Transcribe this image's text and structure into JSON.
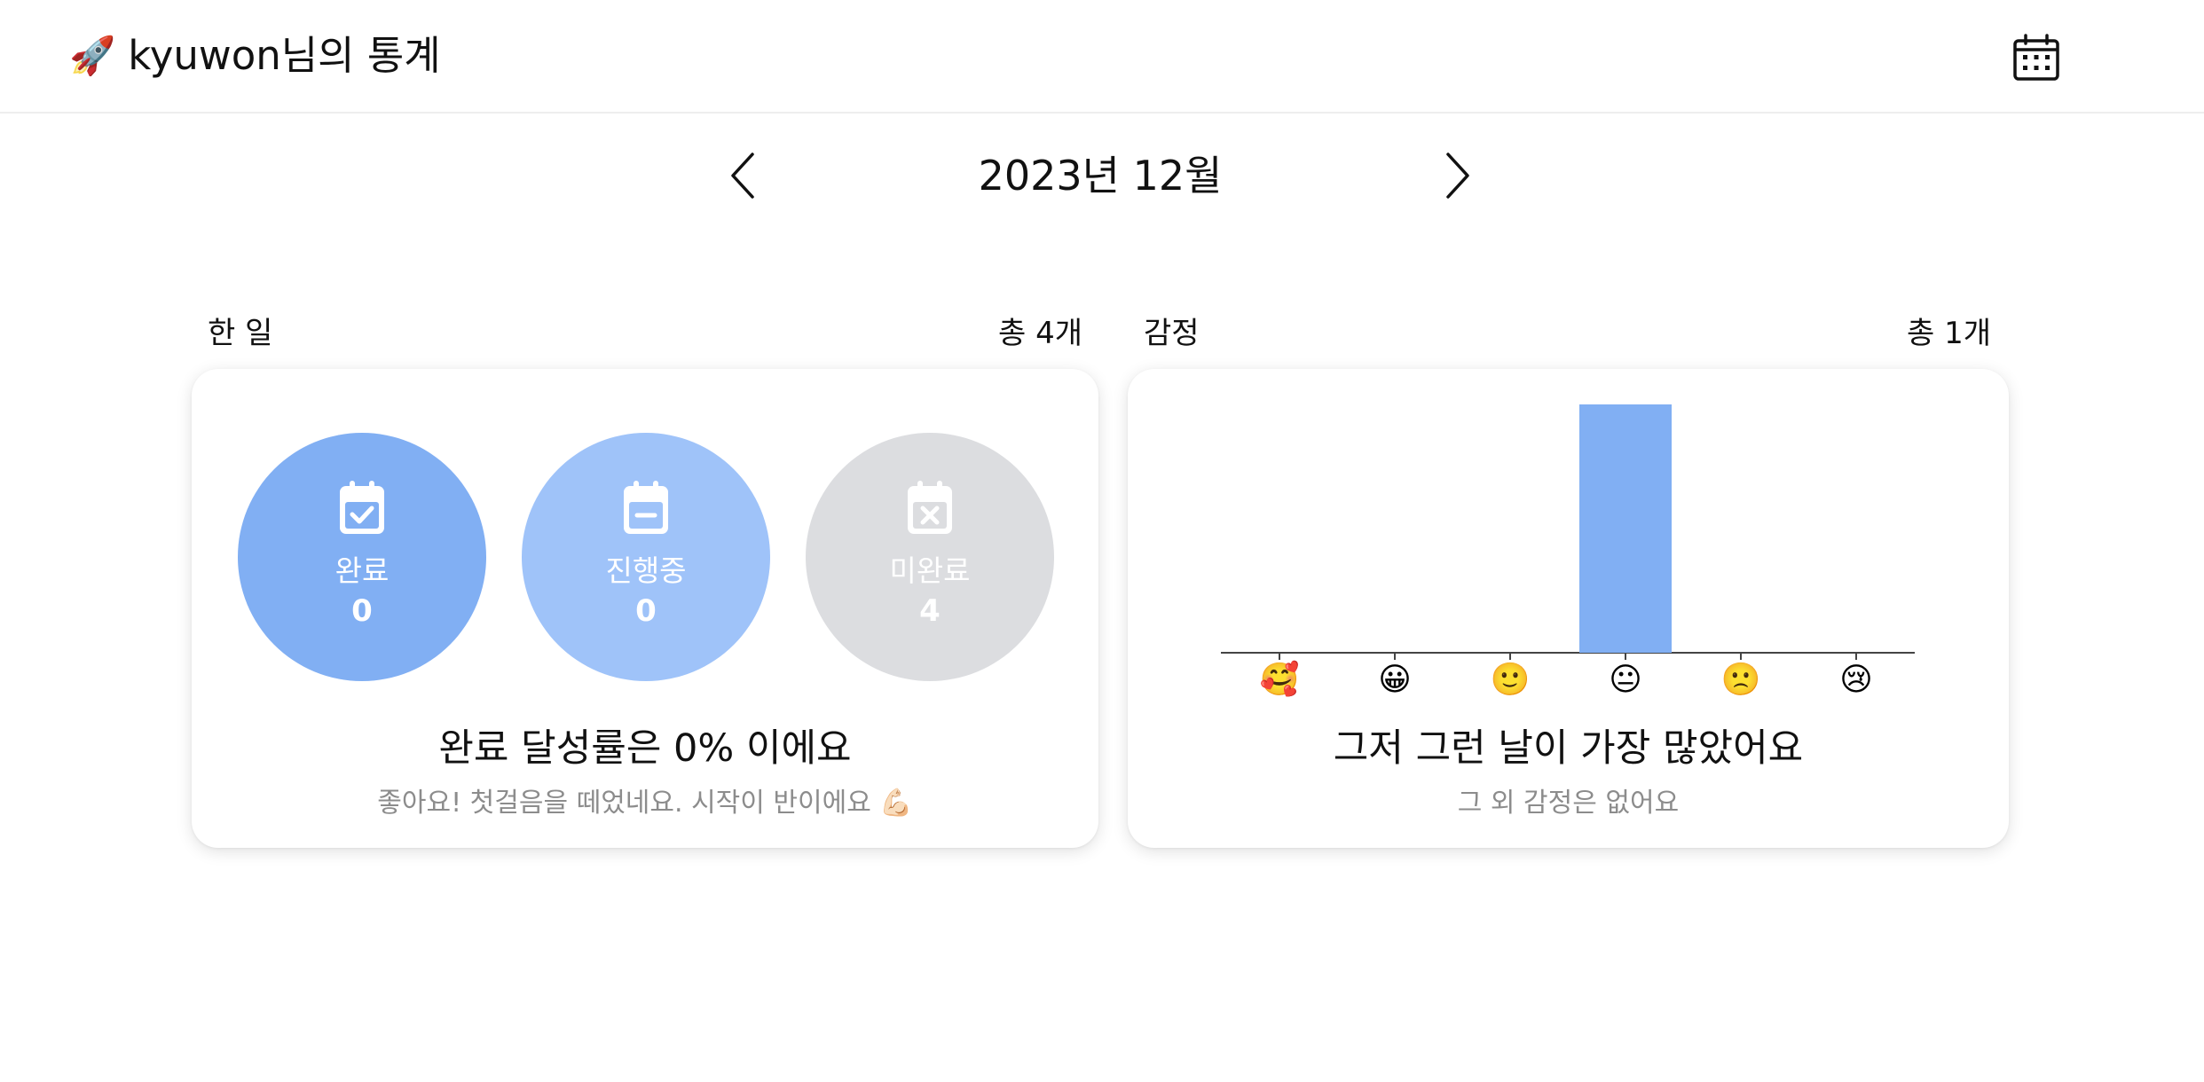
{
  "header": {
    "rocket": "🚀",
    "title": "kyuwon님의 통계",
    "calendar_icon": "calendar-grid-icon"
  },
  "month_nav": {
    "label": "2023년 12월",
    "prev_icon": "chevron-left-icon",
    "next_icon": "chevron-right-icon"
  },
  "tasks": {
    "label": "한 일",
    "total": "총 4개",
    "statuses": [
      {
        "label": "완료",
        "count": "0",
        "color": "#81aff3",
        "icon": "calendar-check-icon"
      },
      {
        "label": "진행중",
        "count": "0",
        "color": "#9fc3f9",
        "icon": "calendar-minus-icon"
      },
      {
        "label": "미완료",
        "count": "4",
        "color": "#dcdde0",
        "icon": "calendar-x-icon"
      }
    ],
    "headline": "완료 달성률은 0% 이에요",
    "message": "좋아요! 첫걸음을 떼었네요. 시작이 반이에요 💪🏻"
  },
  "emotions": {
    "label": "감정",
    "total": "총 1개",
    "headline": "그저 그런 날이 가장 많았어요",
    "message": "그 외 감정은 없어요"
  },
  "chart_data": {
    "type": "bar",
    "categories": [
      "🥰",
      "😀",
      "🙂",
      "😐",
      "🙁",
      "😢"
    ],
    "values": [
      0,
      0,
      0,
      1,
      0,
      0
    ],
    "bar_color": "#81aff3",
    "xlabel": "",
    "ylabel": "",
    "ylim": [
      0,
      1
    ],
    "grid": false
  }
}
